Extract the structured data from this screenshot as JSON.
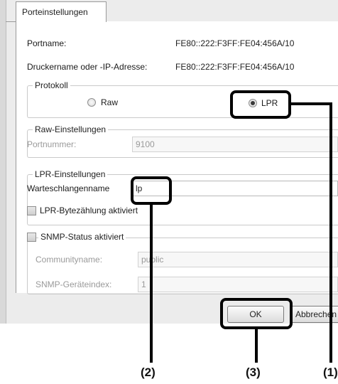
{
  "tab": {
    "label": "Porteinstellungen"
  },
  "port": {
    "name_label": "Portname:",
    "name_value": "FE80::222:F3FF:FE04:456A/10",
    "printer_label": "Druckername oder -IP-Adresse:",
    "printer_value": "FE80::222:F3FF:FE04:456A/10"
  },
  "protocol": {
    "legend": "Protokoll",
    "raw_label": "Raw",
    "lpr_label": "LPR",
    "selected": "LPR"
  },
  "raw_settings": {
    "legend": "Raw-Einstellungen",
    "port_label": "Portnummer:",
    "port_value": "9100"
  },
  "lpr_settings": {
    "legend": "LPR-Einstellungen",
    "queue_label": "Warteschlangenname",
    "queue_value": "lp",
    "bytecount_label": "LPR-Bytezählung aktiviert",
    "bytecount_checked": false
  },
  "snmp": {
    "status_label": "SNMP-Status aktiviert",
    "status_checked": false,
    "community_label": "Communityname:",
    "community_value": "public",
    "index_label": "SNMP-Geräteindex:",
    "index_value": "1"
  },
  "buttons": {
    "ok_label": "OK",
    "cancel_label": "Abbrechen"
  },
  "callouts": {
    "one": "(1)",
    "two": "(2)",
    "three": "(3)"
  }
}
